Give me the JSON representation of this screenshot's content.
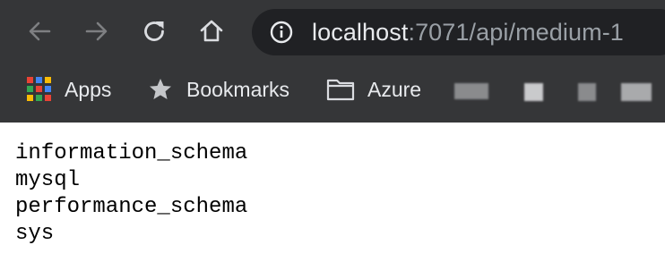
{
  "toolbar": {
    "back_icon": "arrow-left-icon",
    "forward_icon": "arrow-right-icon",
    "reload_icon": "reload-icon",
    "home_icon": "home-icon"
  },
  "omnibox": {
    "security_icon": "info-icon",
    "url_host": "localhost",
    "url_rest": ":7071/api/medium-1"
  },
  "bookmarks": {
    "items": [
      {
        "label": "Apps",
        "icon": "apps-grid-icon"
      },
      {
        "label": "Bookmarks",
        "icon": "star-icon"
      },
      {
        "label": "Azure",
        "icon": "folder-icon"
      }
    ]
  },
  "page": {
    "lines": [
      "information_schema",
      "mysql",
      "performance_schema",
      "sys"
    ]
  },
  "colors": {
    "chrome_bg": "#353638",
    "omnibox_bg": "#202124",
    "icon_color": "#dadce0",
    "disabled_icon": "#7e7f82"
  }
}
